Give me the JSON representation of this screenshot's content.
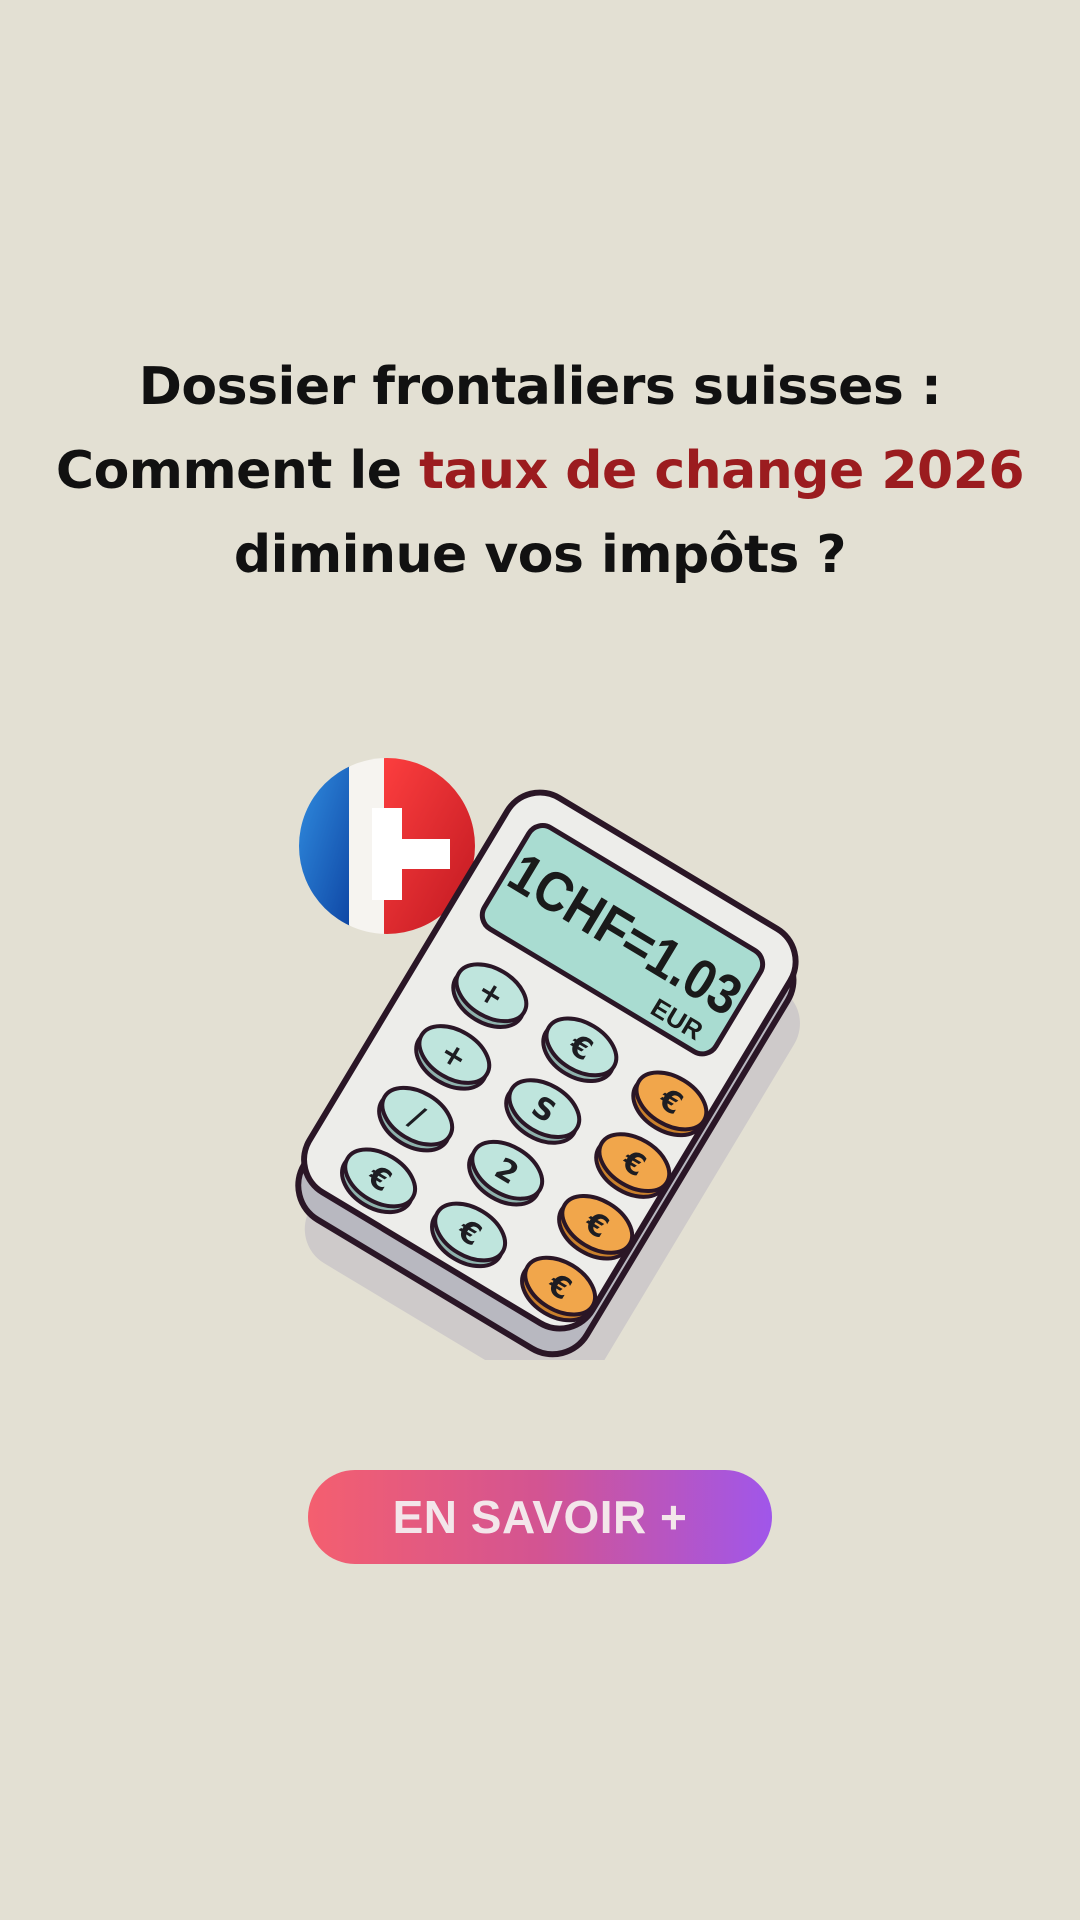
{
  "headline": {
    "line1": "Dossier frontaliers suisses :",
    "line2_prefix": "Comment le ",
    "line2_accent": "taux de change 2026",
    "line3": "diminue vos impôts ?"
  },
  "illustration": {
    "display_main": "1CHF=1.03",
    "display_unit": "EUR",
    "keys": [
      "+",
      "€",
      "€",
      "+",
      "S",
      "€",
      "/",
      "2",
      "€",
      "€",
      "€",
      "€"
    ]
  },
  "cta": {
    "label": "EN SAVOIR +"
  },
  "colors": {
    "background": "#e3e0d3",
    "headline_text": "#111111",
    "headline_accent": "#9b1c1f",
    "cta_gradient_start": "#f45f6f",
    "cta_gradient_end": "#a056ea",
    "cta_text": "#f3e6ea"
  }
}
